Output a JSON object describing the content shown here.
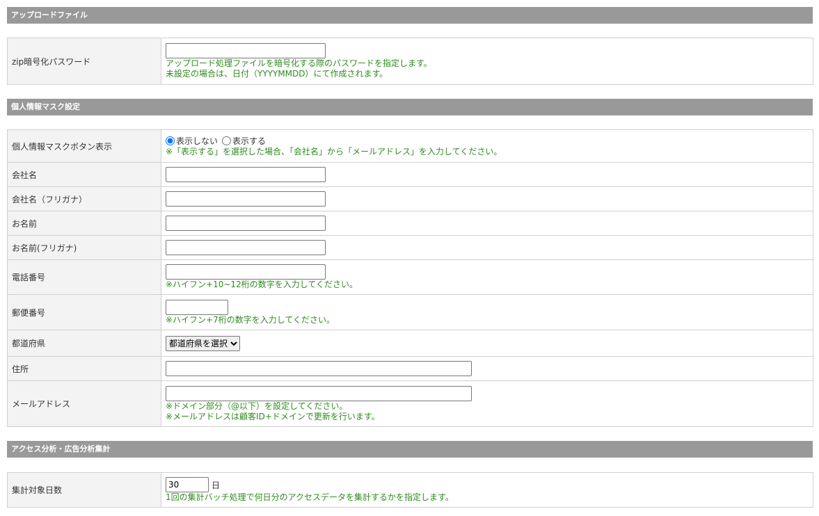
{
  "sections": {
    "upload": {
      "title": "アップロードファイル",
      "zip_label": "zip暗号化パスワード",
      "zip_value": "",
      "zip_notes": [
        "アップロード処理ファイルを暗号化する際のパスワードを指定します。",
        "未設定の場合は、日付（YYYYMMDD）にて作成されます。"
      ]
    },
    "mask": {
      "title": "個人情報マスク設定",
      "button_label": "個人情報マスクボタン表示",
      "radio_hide": "表示しない",
      "radio_show": "表示する",
      "selected": "表示しない",
      "button_note": "※「表示する」を選択した場合、「会社名」から「メールアドレス」を入力してください。",
      "company": "会社名",
      "company_kana": "会社名（フリガナ）",
      "name": "お名前",
      "name_kana": "お名前(フリガナ)",
      "phone": "電話番号",
      "phone_note": "※ハイフン+10~12桁の数字を入力してください。",
      "zip": "郵便番号",
      "zip_note": "※ハイフン+7桁の数字を入力してください。",
      "pref": "都道府県",
      "pref_select": "都道府県を選択",
      "address": "住所",
      "email": "メールアドレス",
      "email_notes": [
        "※ドメイン部分（@以下）を設定してください。",
        "※メールアドレスは顧客ID+ドメインで更新を行います。"
      ]
    },
    "access": {
      "title": "アクセス分析・広告分析集計",
      "days_label": "集計対象日数",
      "days_value": "30",
      "days_unit": "日",
      "days_note": "1回の集計バッチ処理で何日分のアクセスデータを集計するかを指定します。"
    }
  }
}
